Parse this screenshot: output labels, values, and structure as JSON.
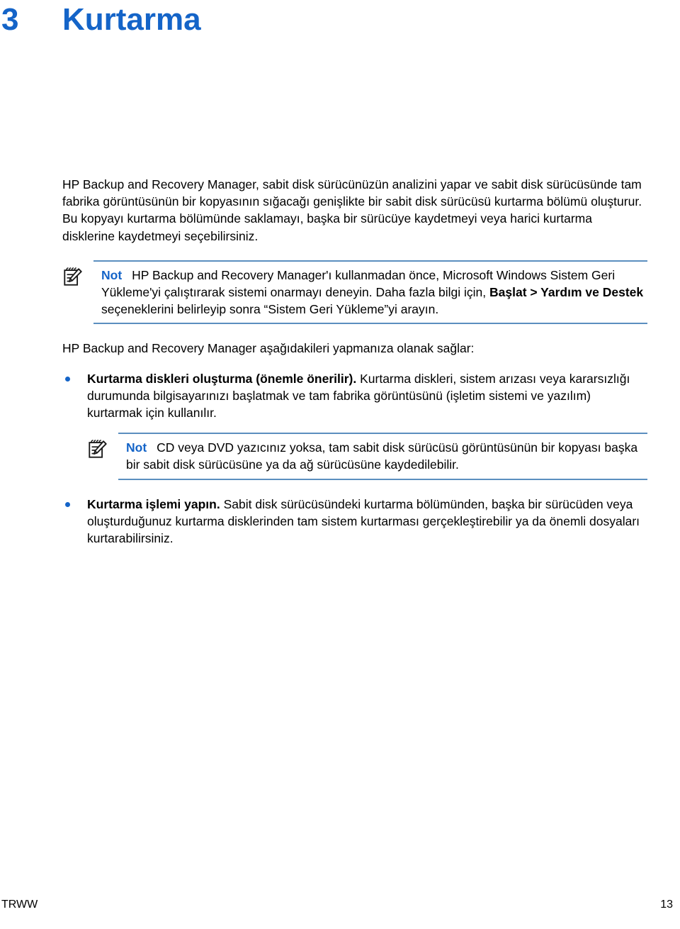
{
  "chapter": {
    "number": "3",
    "title": "Kurtarma"
  },
  "intro": {
    "paragraph": "HP Backup and Recovery Manager, sabit disk sürücünüzün analizini yapar ve sabit disk sürücüsünde tam fabrika görüntüsünün bir kopyasının sığacağı genişlikte bir sabit disk sürücüsü kurtarma bölümü oluşturur. Bu kopyayı kurtarma bölümünde saklamayı, başka bir sürücüye kaydetmeyi veya harici kurtarma disklerine kaydetmeyi seçebilirsiniz."
  },
  "note1": {
    "icon": "note-pencil-icon",
    "label": "Not",
    "text_part1": "HP Backup and Recovery Manager'ı kullanmadan önce, Microsoft Windows Sistem Geri Yükleme'yi çalıştırarak sistemi onarmayı deneyin. Daha fazla bilgi için, ",
    "bold_part": "Başlat > Yardım ve Destek",
    "text_part2": " seçeneklerini belirleyip sonra “Sistem Geri Yükleme”yi arayın."
  },
  "lead_in": {
    "paragraph": "HP Backup and Recovery Manager aşağıdakileri yapmanıza olanak sağlar:"
  },
  "bullets": [
    {
      "bold_lead": "Kurtarma diskleri oluşturma (önemle önerilir).",
      "text": " Kurtarma diskleri, sistem arızası veya kararsızlığı durumunda bilgisayarınızı başlatmak ve tam fabrika görüntüsünü (işletim sistemi ve yazılım) kurtarmak için kullanılır."
    },
    {
      "bold_lead": "Kurtarma işlemi yapın.",
      "text": " Sabit disk sürücüsündeki kurtarma bölümünden, başka bir sürücüden veya oluşturduğunuz kurtarma disklerinden tam sistem kurtarması gerçekleştirebilir ya da önemli dosyaları kurtarabilirsiniz."
    }
  ],
  "note2": {
    "icon": "note-pencil-icon",
    "label": "Not",
    "text": "CD veya DVD yazıcınız yoksa, tam sabit disk sürücüsü görüntüsünün bir kopyası başka bir sabit disk sürücüsüne ya da ağ sürücüsüne kaydedilebilir."
  },
  "footer": {
    "left": "TRWW",
    "page_number": "13"
  },
  "colors": {
    "heading_blue": "#1464C8",
    "rule_blue": "#5B8FBF",
    "bullet_blue": "#1464C8",
    "text_black": "#000000"
  }
}
